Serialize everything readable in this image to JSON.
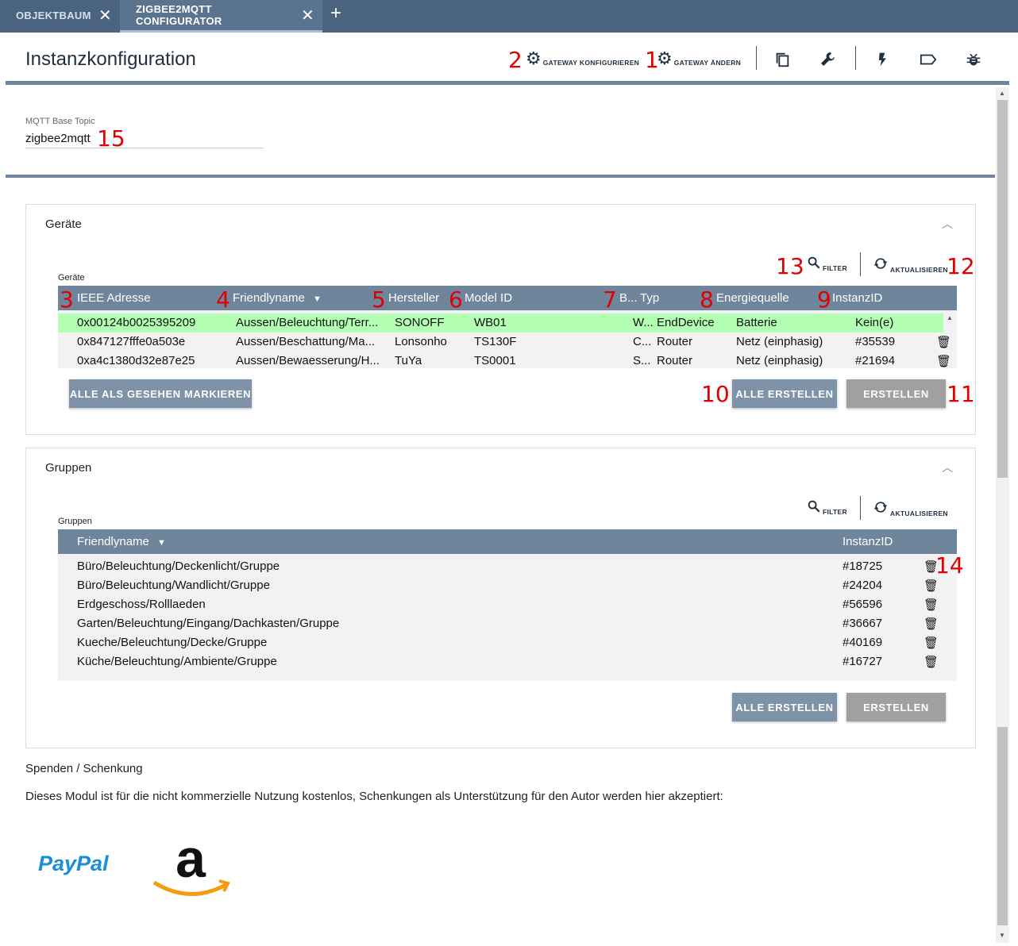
{
  "tabs": [
    {
      "label": "OBJEKTBAUM",
      "close": "✕"
    },
    {
      "label": "ZIGBEE2MQTT CONFIGURATOR",
      "close": "✕"
    }
  ],
  "tab_add": "+",
  "header": {
    "title": "Instanzkonfiguration",
    "gateway_config_label": "GATEWAY KONFIGURIEREN",
    "gateway_change_label": "GATEWAY ÄNDERN",
    "toolbar_icons": [
      "copy-icon",
      "wrench-icon",
      "flash-icon",
      "label-icon",
      "bug-icon"
    ]
  },
  "annotations": [
    "1",
    "2",
    "3",
    "4",
    "5",
    "6",
    "7",
    "8",
    "9",
    "10",
    "11",
    "12",
    "13",
    "14",
    "15"
  ],
  "mqtt": {
    "label": "MQTT Base Topic",
    "value": "zigbee2mqtt"
  },
  "devices": {
    "title": "Geräte",
    "caption": "Geräte",
    "filter_label": "FILTER",
    "refresh_label": "AKTUALISIEREN",
    "columns": [
      "IEEE Adresse",
      "Friendlyname",
      "Hersteller",
      "Model ID",
      "B...",
      "Typ",
      "Energiequelle",
      "InstanzID"
    ],
    "rows": [
      {
        "ieee": "0x00124b0025395209",
        "name": "Aussen/Beleuchtung/Terr...",
        "vendor": "SONOFF",
        "model": "WB01",
        "b": "W...",
        "type": "EndDevice",
        "power": "Batterie",
        "id": "Kein(e)"
      },
      {
        "ieee": "0x847127fffe0a503e",
        "name": "Aussen/Beschattung/Ma...",
        "vendor": "Lonsonho",
        "model": "TS130F",
        "b": "C...",
        "type": "Router",
        "power": "Netz (einphasig)",
        "id": "#35539"
      },
      {
        "ieee": "0xa4c1380d32e87e25",
        "name": "Aussen/Bewaesserung/H...",
        "vendor": "TuYa",
        "model": "TS0001",
        "b": "S...",
        "type": "Router",
        "power": "Netz (einphasig)",
        "id": "#21694"
      }
    ],
    "mark_seen_label": "ALLE ALS GESEHEN MARKIEREN",
    "create_all_label": "ALLE ERSTELLEN",
    "create_label": "ERSTELLEN"
  },
  "groups": {
    "title": "Gruppen",
    "caption": "Gruppen",
    "filter_label": "FILTER",
    "refresh_label": "AKTUALISIEREN",
    "columns": [
      "Friendlyname",
      "InstanzID"
    ],
    "rows": [
      {
        "name": "Büro/Beleuchtung/Deckenlicht/Gruppe",
        "id": "#18725"
      },
      {
        "name": "Büro/Beleuchtung/Wandlicht/Gruppe",
        "id": "#24204"
      },
      {
        "name": "Erdgeschoss/Rolllaeden",
        "id": "#56596"
      },
      {
        "name": "Garten/Beleuchtung/Eingang/Dachkasten/Gruppe",
        "id": "#36667"
      },
      {
        "name": "Kueche/Beleuchtung/Decke/Gruppe",
        "id": "#40169"
      },
      {
        "name": "Küche/Beleuchtung/Ambiente/Gruppe",
        "id": "#16727"
      }
    ],
    "create_all_label": "ALLE ERSTELLEN",
    "create_label": "ERSTELLEN"
  },
  "donate": {
    "title": "Spenden / Schenkung",
    "text": "Dieses Modul ist für die nicht kommerzielle Nutzung kostenlos, Schenkungen als Unterstützung für den Autor werden hier akzeptiert:",
    "paypal_label": "PayPal",
    "amazon_label": "a"
  },
  "colors": {
    "header_bar": "#4a6480",
    "table_head": "#6e859c",
    "selected_row": "#b3ffb3",
    "annotation": "#e00000"
  }
}
